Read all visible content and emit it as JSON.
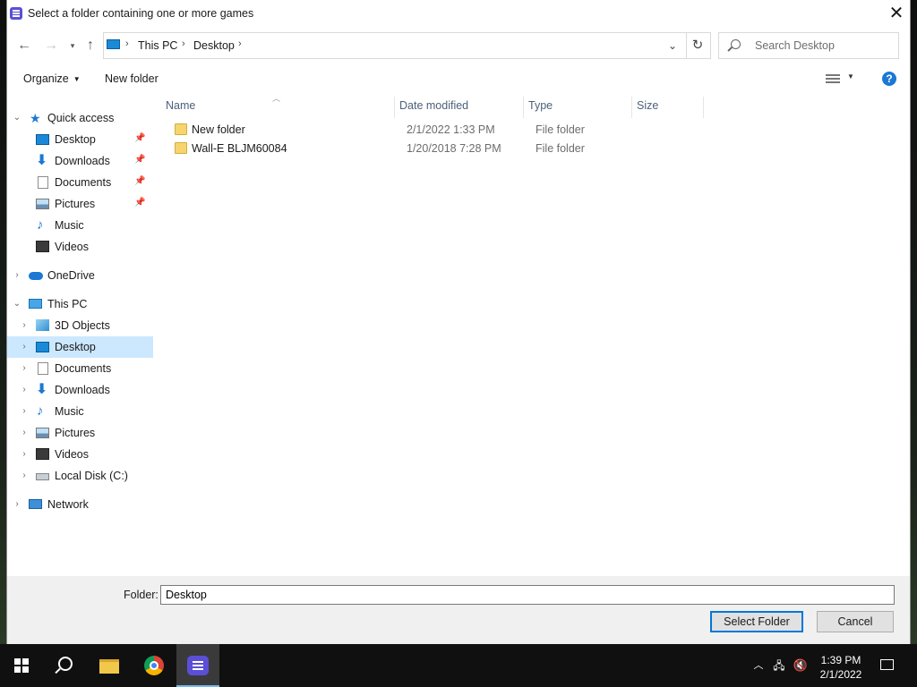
{
  "dialog": {
    "title": "Select a folder containing one or more games",
    "close_label": "✕"
  },
  "address": {
    "crumbs": [
      "This PC",
      "Desktop"
    ],
    "search_placeholder": "Search Desktop"
  },
  "toolbar": {
    "organize": "Organize",
    "new_folder": "New folder",
    "help": "?"
  },
  "nav_pane": {
    "quick_access": "Quick access",
    "quick_items": [
      "Desktop",
      "Downloads",
      "Documents",
      "Pictures",
      "Music",
      "Videos"
    ],
    "onedrive": "OneDrive",
    "this_pc": "This PC",
    "pc_items": [
      "3D Objects",
      "Desktop",
      "Documents",
      "Downloads",
      "Music",
      "Pictures",
      "Videos",
      "Local Disk (C:)"
    ],
    "network": "Network",
    "selected": "Desktop"
  },
  "file_list": {
    "columns": [
      "Name",
      "Date modified",
      "Type",
      "Size"
    ],
    "rows": [
      {
        "name": "New folder",
        "date": "2/1/2022 1:33 PM",
        "type": "File folder"
      },
      {
        "name": "Wall-E BLJM60084",
        "date": "1/20/2018 7:28 PM",
        "type": "File folder"
      }
    ]
  },
  "footer": {
    "folder_label": "Folder:",
    "folder_value": "Desktop",
    "select_button": "Select Folder",
    "cancel_button": "Cancel"
  },
  "taskbar": {
    "time": "1:39 PM",
    "date": "2/1/2022"
  },
  "colors": {
    "accent": "#0078d7",
    "selection": "#cce8ff",
    "taskbar": "#101010"
  }
}
